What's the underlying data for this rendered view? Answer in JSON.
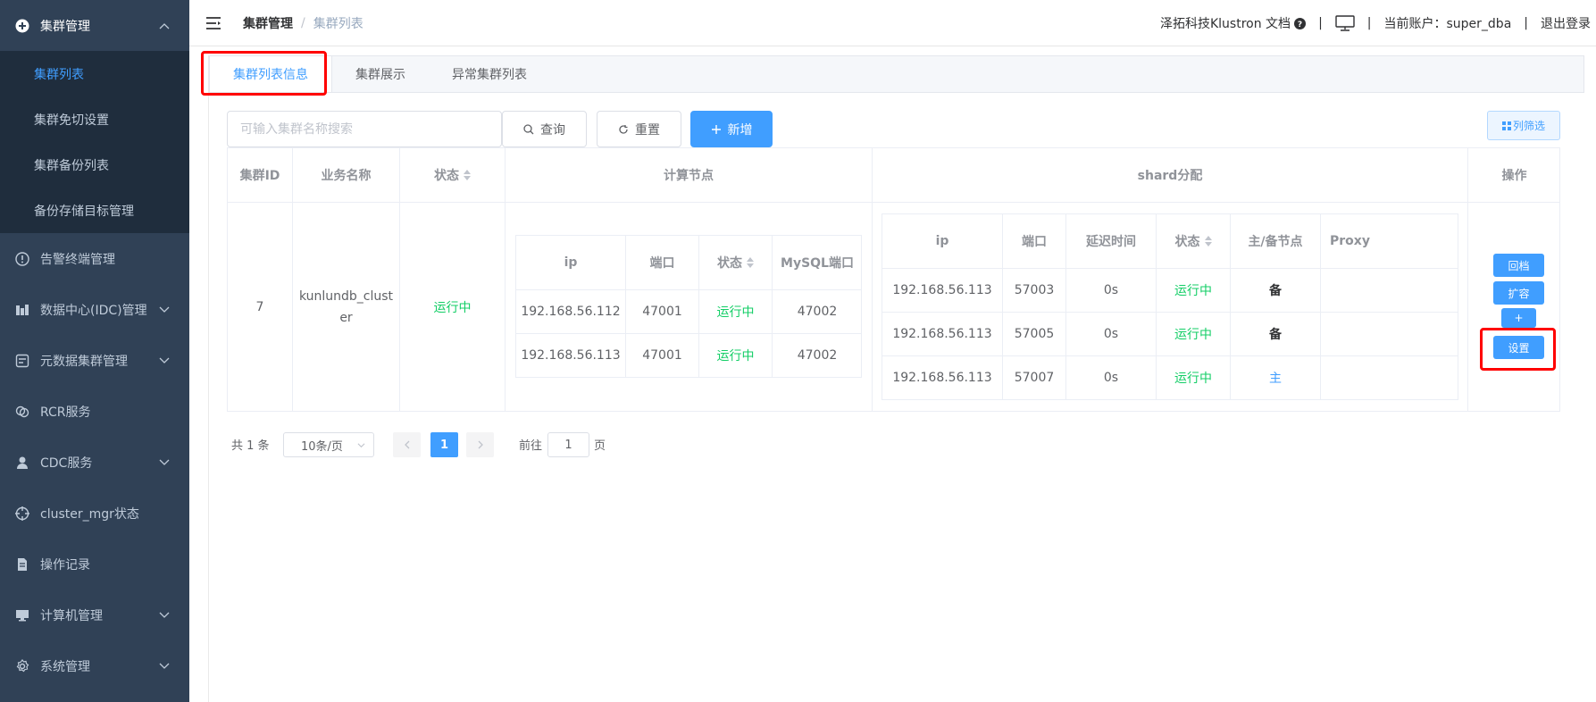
{
  "sidebar": {
    "items": [
      {
        "label": "集群管理",
        "icon": "cluster-icon",
        "expanded": true
      },
      {
        "label": "告警终端管理",
        "icon": "alert-icon"
      },
      {
        "label": "数据中心(IDC)管理",
        "icon": "datacenter-icon"
      },
      {
        "label": "元数据集群管理",
        "icon": "metadata-icon"
      },
      {
        "label": "RCR服务",
        "icon": "rcr-icon"
      },
      {
        "label": "CDC服务",
        "icon": "cdc-icon"
      },
      {
        "label": "cluster_mgr状态",
        "icon": "crosshair-icon"
      },
      {
        "label": "操作记录",
        "icon": "record-icon"
      },
      {
        "label": "计算机管理",
        "icon": "computer-icon"
      },
      {
        "label": "系统管理",
        "icon": "settings-icon"
      }
    ],
    "submenu": [
      "集群列表",
      "集群免切设置",
      "集群备份列表",
      "备份存储目标管理"
    ]
  },
  "header": {
    "breadcrumb": [
      "集群管理",
      "集群列表"
    ],
    "separator": "/",
    "docs_label": "泽拓科技Klustron 文档",
    "sep": "|",
    "account_label": "当前账户：super_dba",
    "logout_label": "退出登录"
  },
  "tabs": [
    "集群列表信息",
    "集群展示",
    "异常集群列表"
  ],
  "toolbar": {
    "search_placeholder": "可输入集群名称搜索",
    "query_label": "查询",
    "reset_label": "重置",
    "add_label": "新增",
    "column_filter_label": "列筛选"
  },
  "table": {
    "headers": {
      "cluster_id": "集群ID",
      "business_name": "业务名称",
      "status": "状态",
      "compute_nodes": "计算节点",
      "shard": "shard分配",
      "operation": "操作"
    },
    "row": {
      "cluster_id": "7",
      "business_name_line1": "kunlundb_clust",
      "business_name_line2": "er",
      "status": "运行中"
    },
    "compute": {
      "headers": [
        "ip",
        "端口",
        "状态",
        "MySQL端口"
      ],
      "rows": [
        [
          "192.168.56.112",
          "47001",
          "运行中",
          "47002"
        ],
        [
          "192.168.56.113",
          "47001",
          "运行中",
          "47002"
        ]
      ]
    },
    "shard": {
      "headers": [
        "ip",
        "端口",
        "延迟时间",
        "状态",
        "主/备节点",
        "Proxy"
      ],
      "rows": [
        [
          "192.168.56.113",
          "57003",
          "0s",
          "运行中",
          "备",
          ""
        ],
        [
          "192.168.56.113",
          "57005",
          "0s",
          "运行中",
          "备",
          ""
        ],
        [
          "192.168.56.113",
          "57007",
          "0s",
          "运行中",
          "主",
          ""
        ]
      ]
    },
    "operations": [
      "回档",
      "扩容",
      "+",
      "设置"
    ]
  },
  "pagination": {
    "total": "共 1 条",
    "page_size": "10条/页",
    "current_page": "1",
    "goto_label": "前往",
    "goto_value": "1",
    "page_label": "页"
  },
  "colors": {
    "sidebar_bg": "#304156",
    "submenu_bg": "#1f2d3d",
    "primary": "#409eff",
    "success": "#13ce66",
    "highlight": "#ff0000"
  }
}
